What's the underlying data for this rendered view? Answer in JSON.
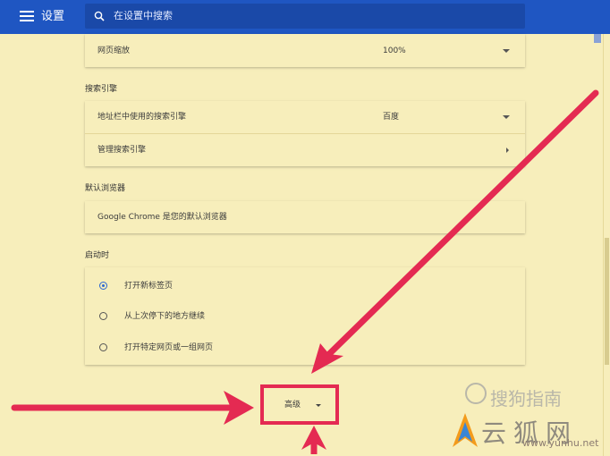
{
  "header": {
    "title": "设置",
    "search_placeholder": "在设置中搜索"
  },
  "page_zoom": {
    "label": "网页缩放",
    "value": "100%"
  },
  "search_engine": {
    "section_title": "搜索引擎",
    "address_bar_label": "地址栏中使用的搜索引擎",
    "address_bar_value": "百度",
    "manage_label": "管理搜索引擎"
  },
  "default_browser": {
    "section_title": "默认浏览器",
    "status_text": "Google Chrome 是您的默认浏览器"
  },
  "on_startup": {
    "section_title": "启动时",
    "options": [
      {
        "label": "打开新标签页",
        "selected": true
      },
      {
        "label": "从上次停下的地方继续",
        "selected": false
      },
      {
        "label": "打开特定网页或一组网页",
        "selected": false
      }
    ]
  },
  "advanced": {
    "label": "高级"
  },
  "annotation_color": "#e42a52",
  "watermarks": {
    "top": "搜狗指南",
    "bottom": "云狐网",
    "url": "www.yunhu.net"
  }
}
